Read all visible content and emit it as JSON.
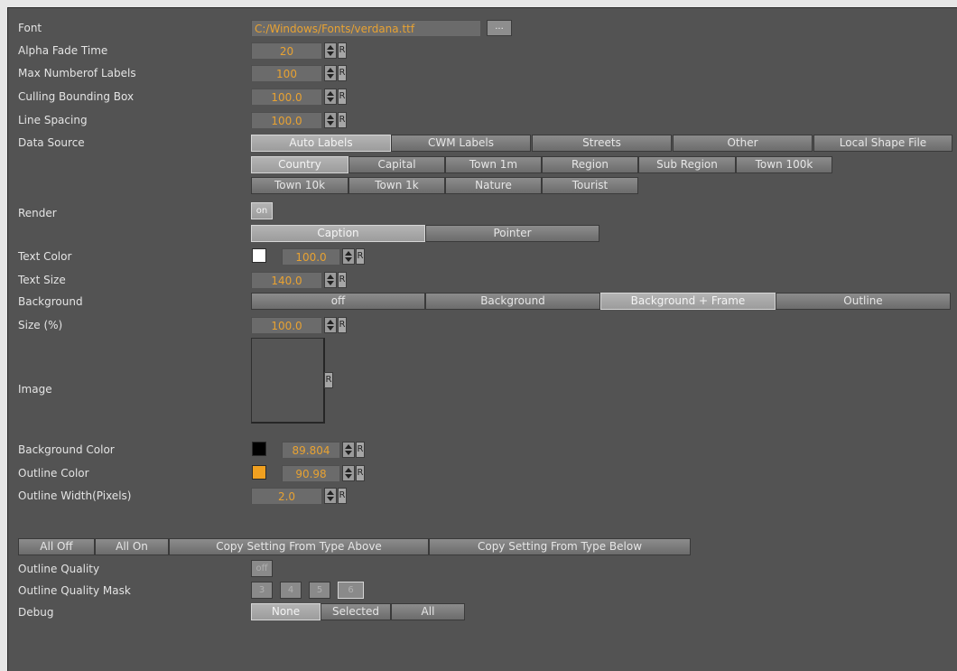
{
  "labels": {
    "font": "Font",
    "alpha_fade_time": "Alpha Fade Time",
    "max_labels": "Max Numberof Labels",
    "culling_bbox": "Culling Bounding Box",
    "line_spacing": "Line Spacing",
    "data_source": "Data Source",
    "render": "Render",
    "text_color": "Text Color",
    "text_size": "Text Size",
    "background": "Background",
    "size_pct": "Size (%)",
    "image": "Image",
    "background_color": "Background Color",
    "outline_color": "Outline Color",
    "outline_width": "Outline Width(Pixels)",
    "outline_quality": "Outline Quality",
    "outline_quality_mask": "Outline Quality Mask",
    "debug": "Debug"
  },
  "values": {
    "font_path": "C:/Windows/Fonts/verdana.ttf",
    "browse": "...",
    "alpha_fade_time": "20",
    "max_labels": "100",
    "culling_bbox": "100.0",
    "line_spacing": "100.0",
    "text_color_alpha": "100.0",
    "text_size": "140.0",
    "size_pct": "100.0",
    "bg_color_alpha": "89.804",
    "outline_color_alpha": "90.98",
    "outline_width": "2.0",
    "reset": "R",
    "render_toggle": "on",
    "outline_quality_toggle": "off"
  },
  "data_source": {
    "row1": [
      "Auto Labels",
      "CWM Labels",
      "Streets",
      "Other",
      "Local Shape File"
    ],
    "row2": [
      "Country",
      "Capital",
      "Town 1m",
      "Region",
      "Sub Region",
      "Town 100k"
    ],
    "row3": [
      "Town 10k",
      "Town 1k",
      "Nature",
      "Tourist"
    ]
  },
  "render_mode": [
    "Caption",
    "Pointer"
  ],
  "background_options": [
    "off",
    "Background",
    "Background + Frame",
    "Outline"
  ],
  "actions": [
    "All Off",
    "All On",
    "Copy Setting From Type Above",
    "Copy Setting From Type Below"
  ],
  "quality_mask": [
    "3",
    "4",
    "5",
    "6"
  ],
  "debug_options": [
    "None",
    "Selected",
    "All"
  ],
  "colors": {
    "text_color": "#ffffff",
    "background_color": "#000000",
    "outline_color": "#f0a020",
    "accent_text": "#e8a232",
    "panel": "#535353"
  }
}
